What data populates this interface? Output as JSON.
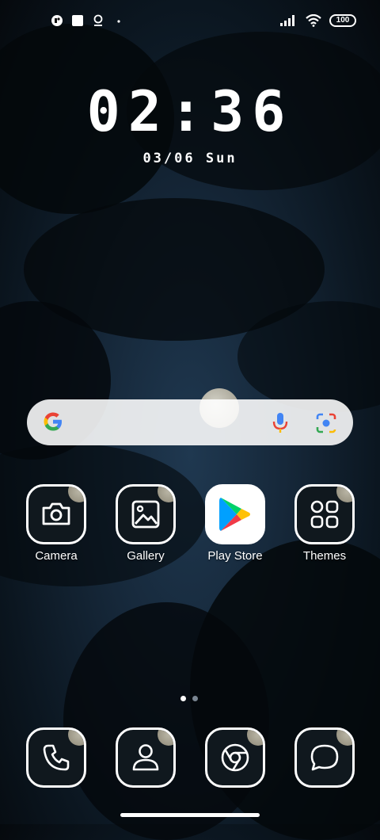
{
  "status_bar": {
    "left_icons": [
      "notification-icon",
      "square-notification-icon",
      "location-icon",
      "dot-icon"
    ],
    "right_icons": [
      "signal-icon",
      "wifi-icon"
    ],
    "battery": "100"
  },
  "lock_clock": {
    "time": "02:36",
    "date": "03/06 Sun"
  },
  "search_bar": {
    "icons": [
      "google-icon",
      "mic-icon",
      "lens-icon"
    ]
  },
  "apps": [
    {
      "label": "Camera",
      "icon": "camera-icon"
    },
    {
      "label": "Gallery",
      "icon": "gallery-icon"
    },
    {
      "label": "Play Store",
      "icon": "play-store-icon"
    },
    {
      "label": "Themes",
      "icon": "themes-icon"
    }
  ],
  "page_indicator": {
    "pages": 2,
    "current": 1
  },
  "dock": [
    {
      "icon": "phone-icon"
    },
    {
      "icon": "contacts-icon"
    },
    {
      "icon": "chrome-icon"
    },
    {
      "icon": "messages-icon"
    }
  ]
}
